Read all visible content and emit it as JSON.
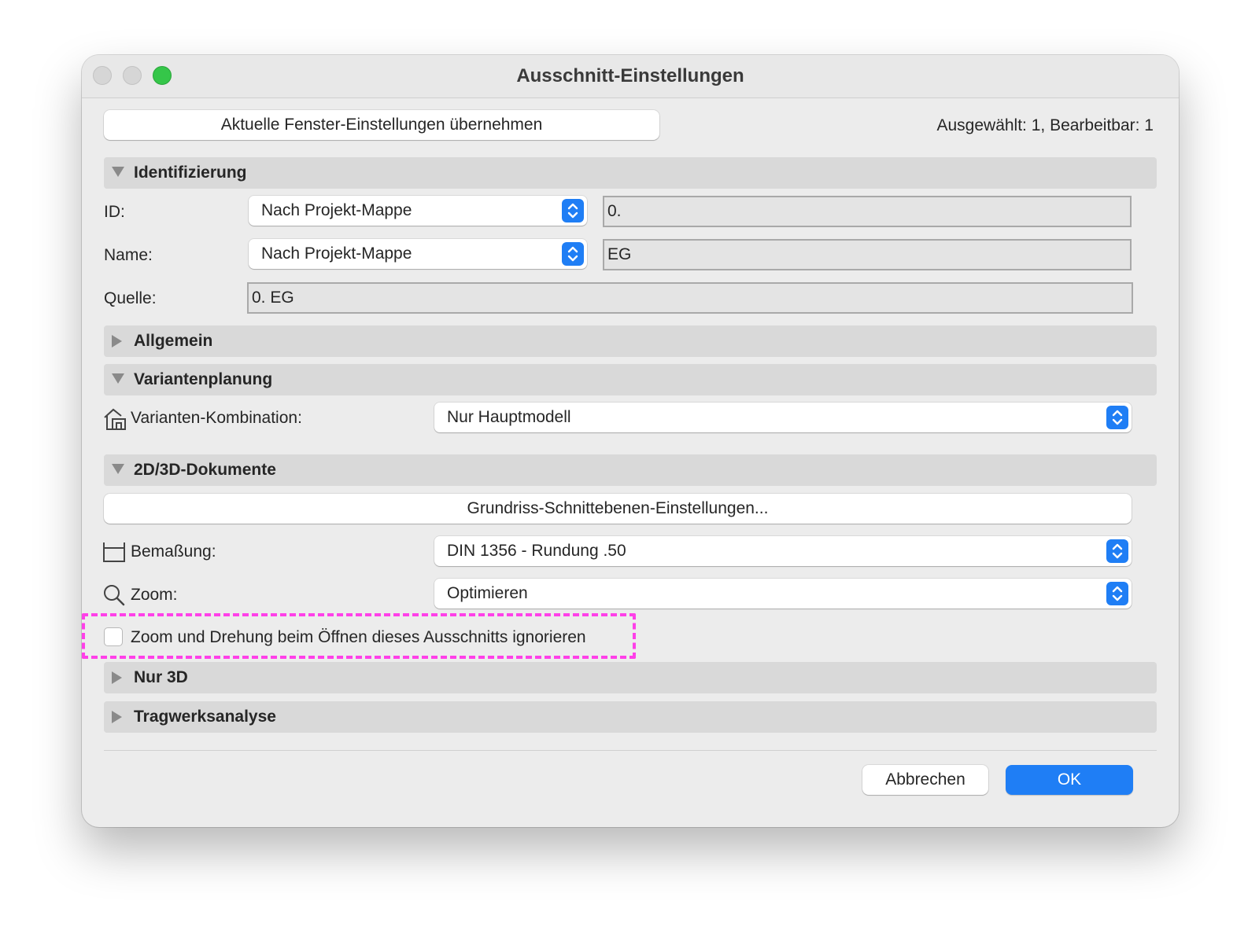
{
  "window": {
    "title": "Ausschnitt-Einstellungen"
  },
  "top": {
    "apply_button": "Aktuelle Fenster-Einstellungen übernehmen",
    "status": "Ausgewählt: 1, Bearbeitbar: 1"
  },
  "sections": {
    "identifizierung": "Identifizierung",
    "allgemein": "Allgemein",
    "variantenplanung": "Variantenplanung",
    "dokumente": "2D/3D-Dokumente",
    "nur3d": "Nur 3D",
    "tragwerk": "Tragwerksanalyse"
  },
  "identifizierung": {
    "id_label": "ID:",
    "id_popup": "Nach Projekt-Mappe",
    "id_value": "0.",
    "name_label": "Name:",
    "name_popup": "Nach Projekt-Mappe",
    "name_value": "EG",
    "source_label": "Quelle:",
    "source_value": "0. EG"
  },
  "variantenplanung": {
    "combination_label": "Varianten-Kombination:",
    "combination_value": "Nur Hauptmodell"
  },
  "dokumente": {
    "cut_plane_button": "Grundriss-Schnittebenen-Einstellungen...",
    "dimension_label": "Bemaßung:",
    "dimension_value": "DIN 1356 - Rundung .50",
    "zoom_label": "Zoom:",
    "zoom_value": "Optimieren",
    "ignore_zoom_checkbox": "Zoom und Drehung beim Öffnen dieses Ausschnitts ignorieren",
    "ignore_zoom_checked": false
  },
  "footer": {
    "cancel": "Abbrechen",
    "ok": "OK"
  },
  "colors": {
    "accent": "#1f7ef5",
    "highlight": "#ff40e8",
    "window_bg": "#ececec",
    "section_bg": "#d9d9d9"
  }
}
